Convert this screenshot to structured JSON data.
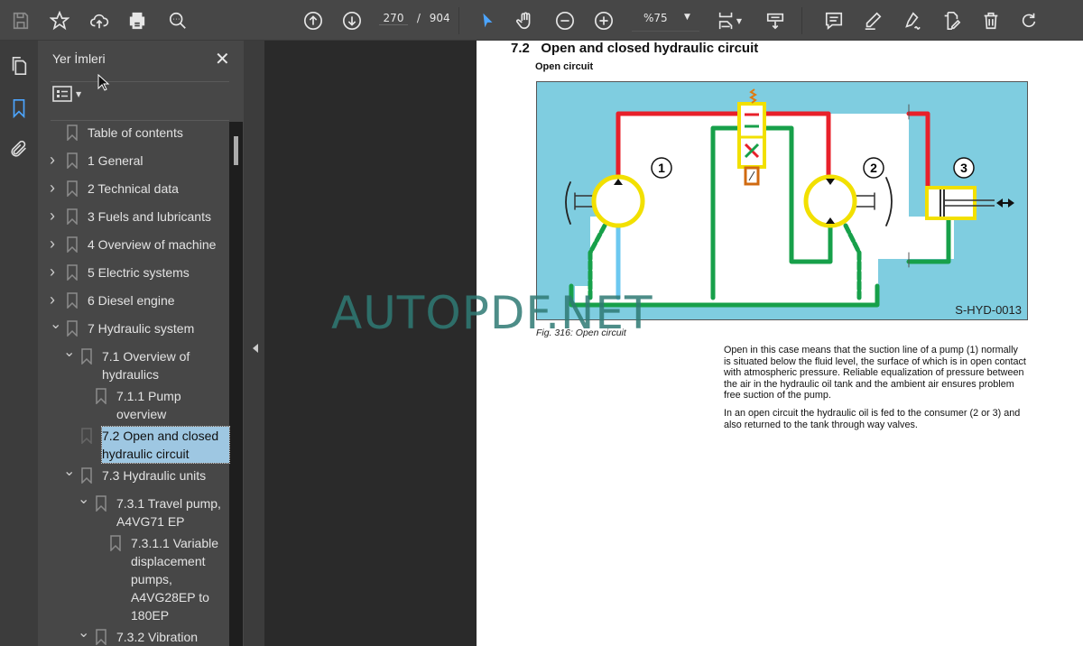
{
  "toolbar": {
    "icons": [
      "save-icon",
      "bookmark-star-icon",
      "cloud-upload-icon",
      "print-icon",
      "find-icon",
      "page-up-icon",
      "page-down-icon",
      "select-cursor-icon",
      "hand-icon",
      "zoom-out-icon",
      "zoom-in-icon",
      "fit-page-icon",
      "scroll-mode-icon",
      "comment-icon",
      "highlight-icon",
      "sign-icon",
      "edit-pdf-icon",
      "delete-icon",
      "rotate-icon"
    ],
    "current_page": "270",
    "page_separator": "/",
    "total_pages": "904",
    "zoom": "%75",
    "accent": "#4ca5ff"
  },
  "sidebar": {
    "title": "Yer İmleri",
    "items": [
      {
        "label": "Table of contents",
        "level": 0,
        "expandable": false
      },
      {
        "label": "1 General",
        "level": 0,
        "expandable": true,
        "expanded": false
      },
      {
        "label": "2 Technical data",
        "level": 0,
        "expandable": true,
        "expanded": false
      },
      {
        "label": "3 Fuels and lubricants",
        "level": 0,
        "expandable": true,
        "expanded": false
      },
      {
        "label": "4 Overview of machine",
        "level": 0,
        "expandable": true,
        "expanded": false
      },
      {
        "label": "5 Electric systems",
        "level": 0,
        "expandable": true,
        "expanded": false
      },
      {
        "label": "6 Diesel engine",
        "level": 0,
        "expandable": true,
        "expanded": false
      },
      {
        "label": "7 Hydraulic system",
        "level": 0,
        "expandable": true,
        "expanded": true
      },
      {
        "label": "7.1 Overview of hydraulics",
        "level": 1,
        "expandable": true,
        "expanded": true
      },
      {
        "label": "7.1.1 Pump overview",
        "level": 2,
        "expandable": false
      },
      {
        "label": "7.2 Open and closed hydraulic circuit",
        "level": 1,
        "expandable": false,
        "selected": true
      },
      {
        "label": "7.3 Hydraulic units",
        "level": 1,
        "expandable": true,
        "expanded": true
      },
      {
        "label": "7.3.1 Travel pump, A4VG71 EP",
        "level": 2,
        "expandable": true,
        "expanded": true
      },
      {
        "label": "7.3.1.1 Variable displacement pumps, A4VG28EP to 180EP",
        "level": 3,
        "expandable": false
      },
      {
        "label": "7.3.2 Vibration",
        "level": 2,
        "expandable": true,
        "expanded": true
      }
    ]
  },
  "document": {
    "section_title": "7.2   Open and closed hydraulic circuit",
    "subtitle": "Open circuit",
    "figure": {
      "labels": [
        "1",
        "2",
        "3"
      ],
      "code": "S-HYD-0013",
      "caption": "Fig. 316: Open circuit",
      "colors": {
        "background": "#7fcde0",
        "pressure": "#e8202a",
        "return": "#17a04a",
        "suction": "#6cc8f0",
        "component": "#f2e000"
      }
    },
    "paragraphs": [
      "Open in this case means that the suction line of a pump (1) normally is situated below the fluid level, the surface of which is in open contact with atmospheric pressure. Reliable equalization of pressure between the air in the hydraulic oil tank and the ambient air ensures problem free suction of the pump.",
      "In an open circuit the hydraulic oil is fed to the consumer (2 or 3) and also returned to the tank through way valves."
    ]
  },
  "watermark": "AUTOPDF.NET"
}
